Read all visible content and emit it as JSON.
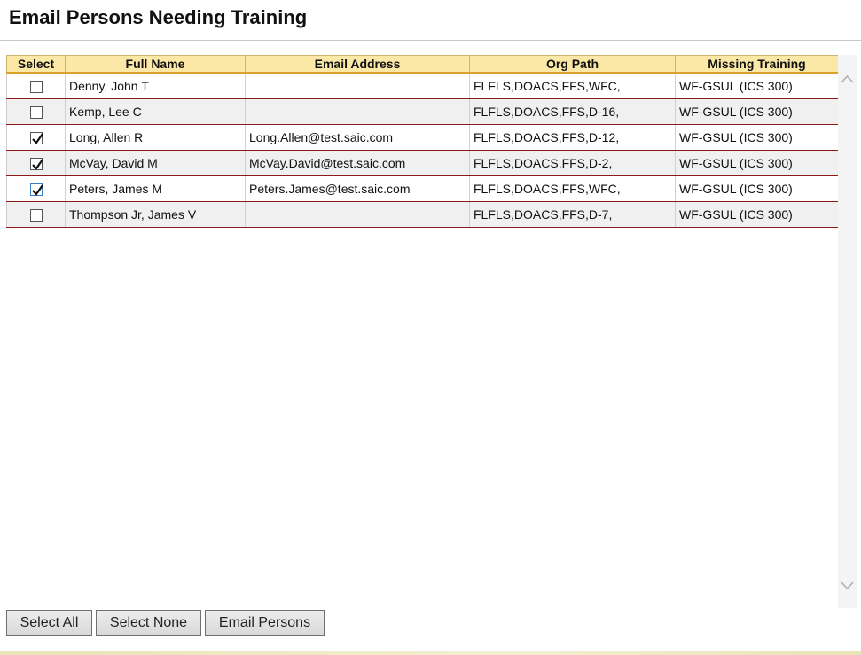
{
  "page": {
    "title": "Email Persons Needing Training"
  },
  "table": {
    "columns": [
      "Select",
      "Full Name",
      "Email Address",
      "Org Path",
      "Missing Training"
    ],
    "rows": [
      {
        "selected": false,
        "name": "Denny, John T",
        "email": "",
        "org": "FLFLS,DOACS,FFS,WFC,",
        "training": "WF-GSUL (ICS 300)"
      },
      {
        "selected": false,
        "name": "Kemp, Lee C",
        "email": "",
        "org": "FLFLS,DOACS,FFS,D-16,",
        "training": "WF-GSUL (ICS 300)"
      },
      {
        "selected": true,
        "name": "Long, Allen R",
        "email": "Long.Allen@test.saic.com",
        "org": "FLFLS,DOACS,FFS,D-12,",
        "training": "WF-GSUL (ICS 300)"
      },
      {
        "selected": true,
        "name": "McVay, David M",
        "email": "McVay.David@test.saic.com",
        "org": "FLFLS,DOACS,FFS,D-2,",
        "training": "WF-GSUL (ICS 300)"
      },
      {
        "selected": true,
        "name": "Peters, James M",
        "email": "Peters.James@test.saic.com",
        "org": "FLFLS,DOACS,FFS,WFC,",
        "training": "WF-GSUL (ICS 300)"
      },
      {
        "selected": false,
        "name": "Thompson Jr, James V",
        "email": "",
        "org": "FLFLS,DOACS,FFS,D-7,",
        "training": "WF-GSUL (ICS 300)"
      }
    ]
  },
  "buttons": {
    "select_all": "Select All",
    "select_none": "Select None",
    "email_persons": "Email Persons"
  },
  "icons": {
    "scroll_up": "chevron-up-icon",
    "scroll_down": "chevron-down-icon",
    "checkmark": "checkmark-icon"
  },
  "colors": {
    "header_bg": "#fbe8a6",
    "row_border": "#8b1a1a",
    "alt_row_bg": "#f0f0f0",
    "focus_border": "#3b7fc4"
  }
}
